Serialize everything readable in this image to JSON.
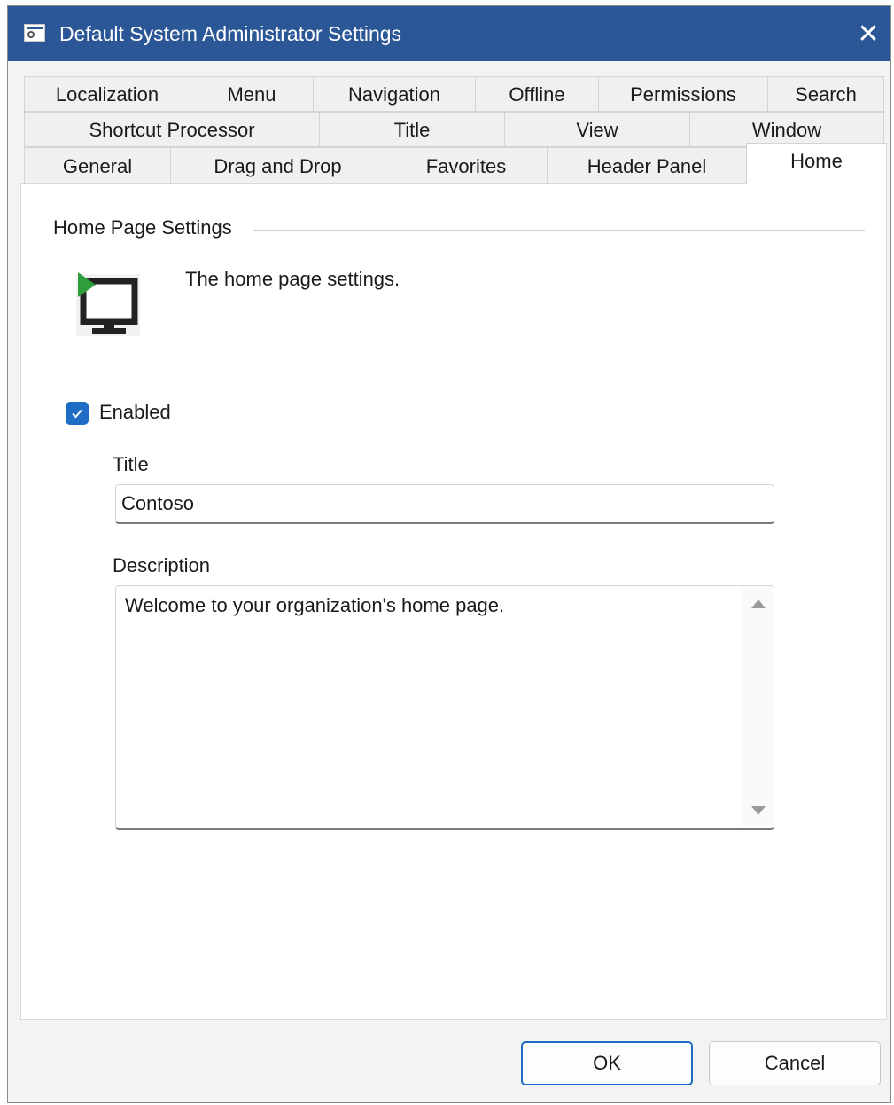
{
  "window": {
    "title": "Default System Administrator Settings",
    "close_glyph": "✕",
    "accent_color": "#2b5797"
  },
  "tabs": {
    "row1": [
      "Localization",
      "Menu",
      "Navigation",
      "Offline",
      "Permissions",
      "Search"
    ],
    "row2": [
      "Shortcut Processor",
      "Title",
      "View",
      "Window"
    ],
    "row3": [
      "General",
      "Drag and Drop",
      "Favorites",
      "Header Panel",
      "Home"
    ],
    "active": "Home"
  },
  "home": {
    "group_title": "Home Page Settings",
    "icon": "monitor-play-icon",
    "description": "The home page settings.",
    "enabled_label": "Enabled",
    "enabled": true,
    "title_label": "Title",
    "title_value": "Contoso",
    "description_label": "Description",
    "description_value": "Welcome to your organization's home page."
  },
  "buttons": {
    "ok": "OK",
    "cancel": "Cancel"
  }
}
